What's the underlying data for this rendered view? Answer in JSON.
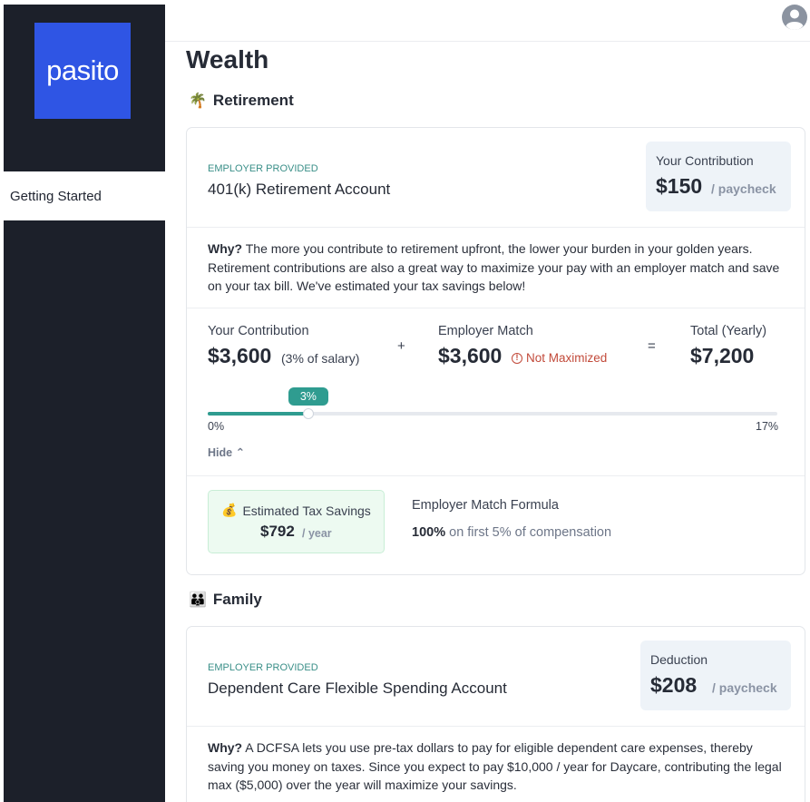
{
  "brand": {
    "logo_text": "pasito",
    "color": "#2f55e4"
  },
  "sidebar": {
    "items": [
      {
        "label": "Getting Started"
      }
    ]
  },
  "header": {
    "avatar_icon": "user-circle-icon"
  },
  "page": {
    "title": "Wealth"
  },
  "retirement": {
    "section_title": "Retirement",
    "section_icon": "palm-tree-icon",
    "eyebrow": "EMPLOYER PROVIDED",
    "account_name": "401(k) Retirement Account",
    "pill": {
      "label": "Your Contribution",
      "amount": "$150",
      "unit": "/ paycheck"
    },
    "why_label": "Why?",
    "why_text": "The more you contribute to retirement upfront, the lower your burden in your golden years. Retirement contributions are also a great way to maximize your pay with an employer match and save on your tax bill. We've estimated your tax savings below!",
    "calc": {
      "your_label": "Your Contribution",
      "your_amount": "$3,600",
      "your_sub": "(3% of salary)",
      "plus": "+",
      "match_label": "Employer Match",
      "match_amount": "$3,600",
      "match_warning": "Not Maximized",
      "equals": "=",
      "total_label": "Total (Yearly)",
      "total_amount": "$7,200"
    },
    "slider": {
      "value_label": "3%",
      "value": 3,
      "min": 0,
      "max": 17,
      "min_label": "0%",
      "max_label": "17%"
    },
    "hide_label": "Hide",
    "savings": {
      "label": "Estimated Tax Savings",
      "icon": "money-bag-icon",
      "amount": "$792",
      "unit": "/ year"
    },
    "formula": {
      "title": "Employer Match Formula",
      "bold": "100%",
      "text": "on first 5% of compensation"
    }
  },
  "family": {
    "section_title": "Family",
    "section_icon": "family-icon",
    "eyebrow": "EMPLOYER PROVIDED",
    "account_name": "Dependent Care Flexible Spending Account",
    "pill": {
      "label": "Deduction",
      "amount": "$208",
      "unit": "/ paycheck"
    },
    "why_label": "Why?",
    "why_text": "A DCFSA lets you use pre-tax dollars to pay for eligible dependent care expenses, thereby saving you money on taxes. Since you expect to pay $10,000 / year for Daycare, contributing the legal max ($5,000) over the year will maximize your savings."
  },
  "colors": {
    "sidebar_bg": "#1c202a",
    "accent_teal": "#2f9c90",
    "warning_red": "#c24a3a",
    "savings_bg": "#edfaf1"
  }
}
